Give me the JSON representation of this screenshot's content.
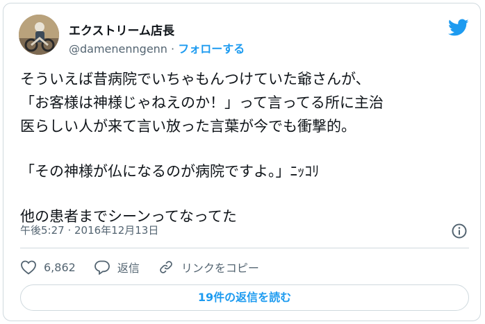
{
  "author": {
    "name": "エクストリーム店長",
    "handle": "@damenenngenn",
    "separator": " · ",
    "follow_label": "フォローする"
  },
  "tweet": {
    "lines": [
      "そういえば昔病院でいちゃもんつけていた爺さんが、",
      "「お客様は神様じゃねえのか！」って言ってる所に主治",
      "医らしい人が来て言い放った言葉が今でも衝撃的。",
      "",
      "「その神様が仏になるのが病院ですよ。」ﾆｯｺﾘ",
      "",
      "他の患者までシーンってなってた"
    ],
    "timestamp": "午後5:27 · 2016年12月13日"
  },
  "actions": {
    "like_count": "6,862",
    "reply_label": "返信",
    "copy_link_label": "リンクをコピー"
  },
  "replies_button": "19件の返信を読む",
  "colors": {
    "accent": "#1d9bf0",
    "secondary_text": "#536471",
    "border": "#cfd9de"
  },
  "icons": [
    "twitter-bird-icon",
    "info-icon",
    "heart-icon",
    "reply-icon",
    "link-icon"
  ]
}
